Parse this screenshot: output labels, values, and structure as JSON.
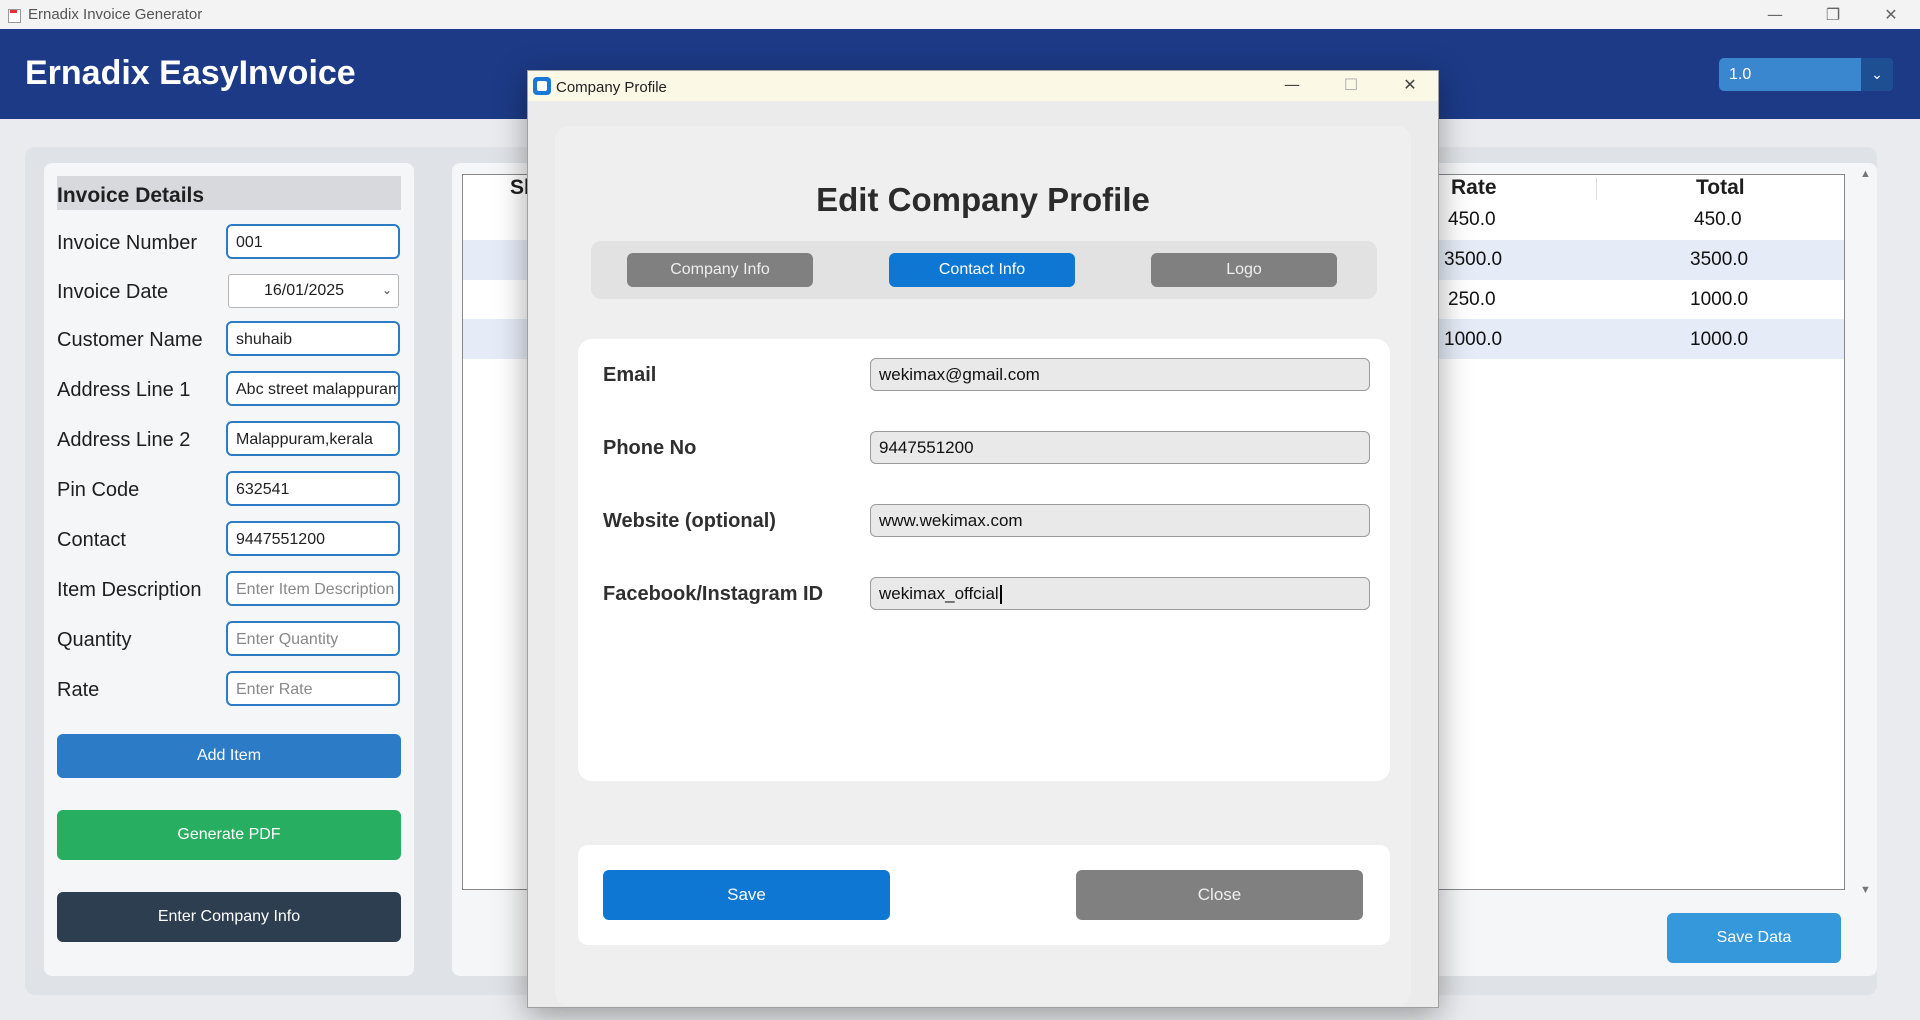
{
  "os": {
    "title": "Ernadix Invoice Generator",
    "controls": {
      "minimize": "—",
      "restore": "❐",
      "close": "✕"
    }
  },
  "header": {
    "brand": "Ernadix EasyInvoice",
    "version": "1.0"
  },
  "invoice_details": {
    "title": "Invoice Details",
    "fields": [
      {
        "label": "Invoice Number",
        "value": "001"
      },
      {
        "label": "Invoice Date",
        "value": "16/01/2025"
      },
      {
        "label": "Customer Name",
        "value": "shuhaib"
      },
      {
        "label": "Address Line 1",
        "value": "Abc street malappuram"
      },
      {
        "label": "Address Line 2",
        "value": "Malappuram,kerala"
      },
      {
        "label": "Pin Code",
        "value": "632541"
      },
      {
        "label": "Contact",
        "value": "9447551200"
      },
      {
        "label": "Item Description",
        "placeholder": "Enter Item Description"
      },
      {
        "label": "Quantity",
        "placeholder": "Enter Quantity"
      },
      {
        "label": "Rate",
        "placeholder": "Enter Rate"
      }
    ],
    "buttons": {
      "add_item": "Add Item",
      "generate_pdf": "Generate PDF",
      "company_info": "Enter Company Info"
    }
  },
  "items_table": {
    "columns": {
      "sl": "Sl",
      "rate": "Rate",
      "total": "Total"
    },
    "rows": [
      {
        "rate": "450.0",
        "total": "450.0"
      },
      {
        "rate": "3500.0",
        "total": "3500.0"
      },
      {
        "rate": "250.0",
        "total": "1000.0"
      },
      {
        "rate": "1000.0",
        "total": "1000.0"
      }
    ],
    "save_button": "Save Data"
  },
  "modal": {
    "window_title": "Company Profile",
    "heading": "Edit Company Profile",
    "tabs": [
      "Company Info",
      "Contact Info",
      "Logo"
    ],
    "active_tab": "Contact Info",
    "fields": [
      {
        "label": "Email",
        "value": "wekimax@gmail.com"
      },
      {
        "label": "Phone No",
        "value": "9447551200"
      },
      {
        "label": "Website (optional)",
        "value": "www.wekimax.com"
      },
      {
        "label": "Facebook/Instagram ID",
        "value": "wekimax_offcial"
      }
    ],
    "buttons": {
      "save": "Save",
      "close": "Close"
    },
    "controls": {
      "minimize": "—",
      "maximize": "☐",
      "close": "✕"
    }
  },
  "colors": {
    "header_bg": "#1c3a86",
    "primary_blue": "#2b7bc6",
    "green": "#27ae60",
    "dark": "#2c3e50",
    "tab_active": "#0e77d3",
    "tab_inactive": "#808080"
  }
}
